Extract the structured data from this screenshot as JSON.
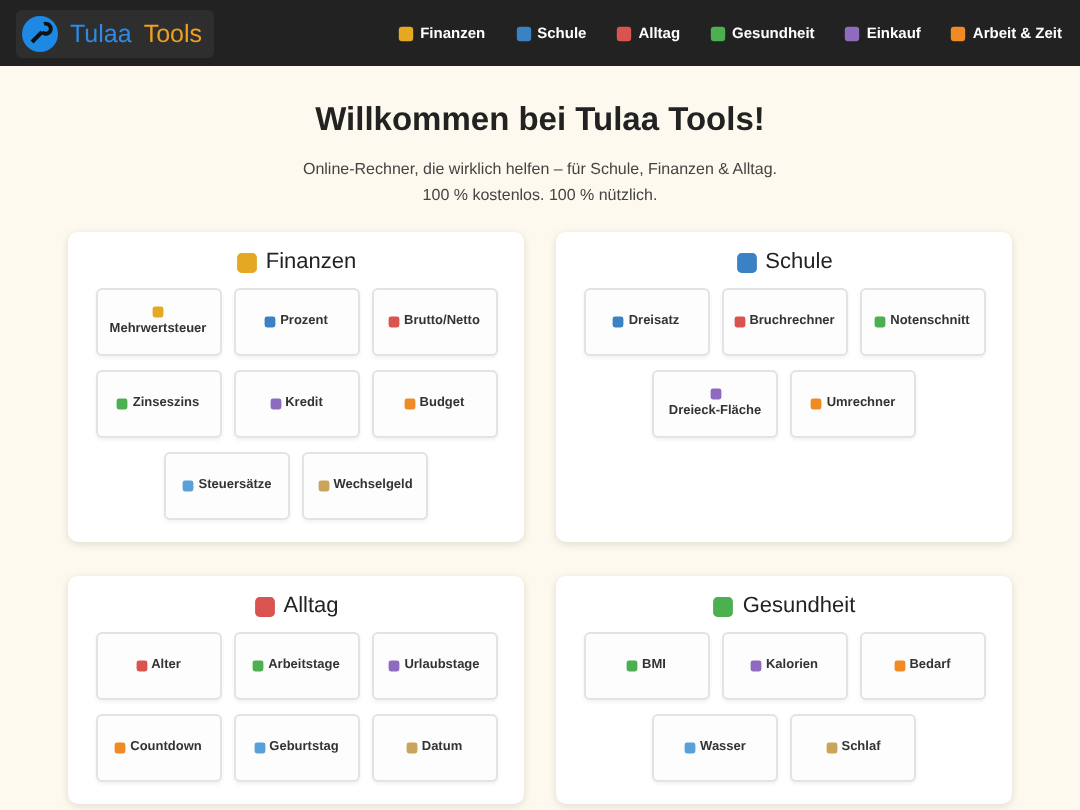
{
  "logo": {
    "first": "Tulaa",
    "second": "Tools"
  },
  "nav": [
    {
      "label": "Finanzen"
    },
    {
      "label": "Schule"
    },
    {
      "label": "Alltag"
    },
    {
      "label": "Gesundheit"
    },
    {
      "label": "Einkauf"
    },
    {
      "label": "Arbeit & Zeit"
    }
  ],
  "hero": {
    "title": "Willkommen bei Tulaa Tools!",
    "subtitle": "Online-Rechner, die wirklich helfen – für Schule, Finanzen & Alltag. 100 % kostenlos. 100 % nützlich."
  },
  "sections": [
    {
      "title": "Finanzen",
      "tools": [
        "Mehrwertsteuer",
        "Prozent",
        "Brutto/Netto",
        "Zinseszins",
        "Kredit",
        "Budget",
        "Steuersätze",
        "Wechselgeld"
      ]
    },
    {
      "title": "Schule",
      "tools": [
        "Dreisatz",
        "Bruchrechner",
        "Notenschnitt",
        "Dreieck-Fläche",
        "Umrechner"
      ]
    },
    {
      "title": "Alltag",
      "tools": [
        "Alter",
        "Arbeitstage",
        "Urlaubstage",
        "Countdown",
        "Geburtstag",
        "Datum"
      ]
    },
    {
      "title": "Gesundheit",
      "tools": [
        "BMI",
        "Kalorien",
        "Bedarf",
        "Wasser",
        "Schlaf"
      ]
    }
  ]
}
